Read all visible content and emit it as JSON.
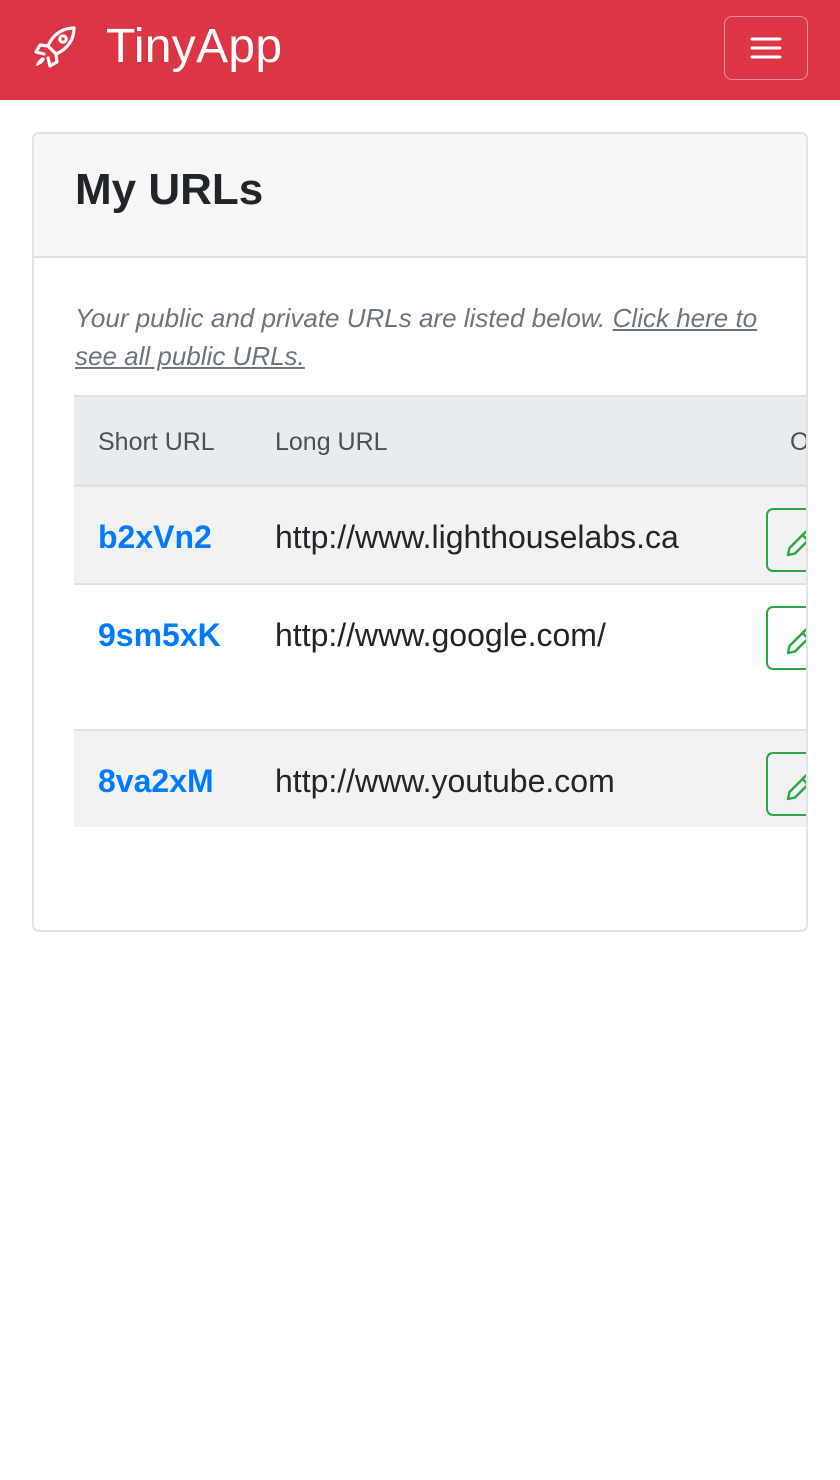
{
  "app": {
    "name": "TinyApp",
    "brand_color": "#dc3545",
    "brand_icon": "rocket-icon",
    "menu_icon": "hamburger-menu-icon"
  },
  "page": {
    "title": "My URLs",
    "intro_text": "Your public and private URLs are listed below. ",
    "intro_link": "Click here to see all public URLs."
  },
  "table": {
    "columns": [
      "Short URL",
      "Long URL",
      "O"
    ],
    "rows": [
      {
        "short_url": "b2xVn2",
        "long_url": "http://www.lighthouselabs.ca",
        "action_icon": "pencil-icon"
      },
      {
        "short_url": "9sm5xK",
        "long_url": "http://www.google.com/",
        "action_icon": "pencil-icon"
      },
      {
        "short_url": "8va2xM",
        "long_url": "http://www.youtube.com",
        "action_icon": "pencil-icon"
      }
    ]
  },
  "colors": {
    "link": "#007bff",
    "edit_button": "#28a745",
    "header_row": "#e9ecef",
    "striped_row": "#f2f2f2"
  }
}
